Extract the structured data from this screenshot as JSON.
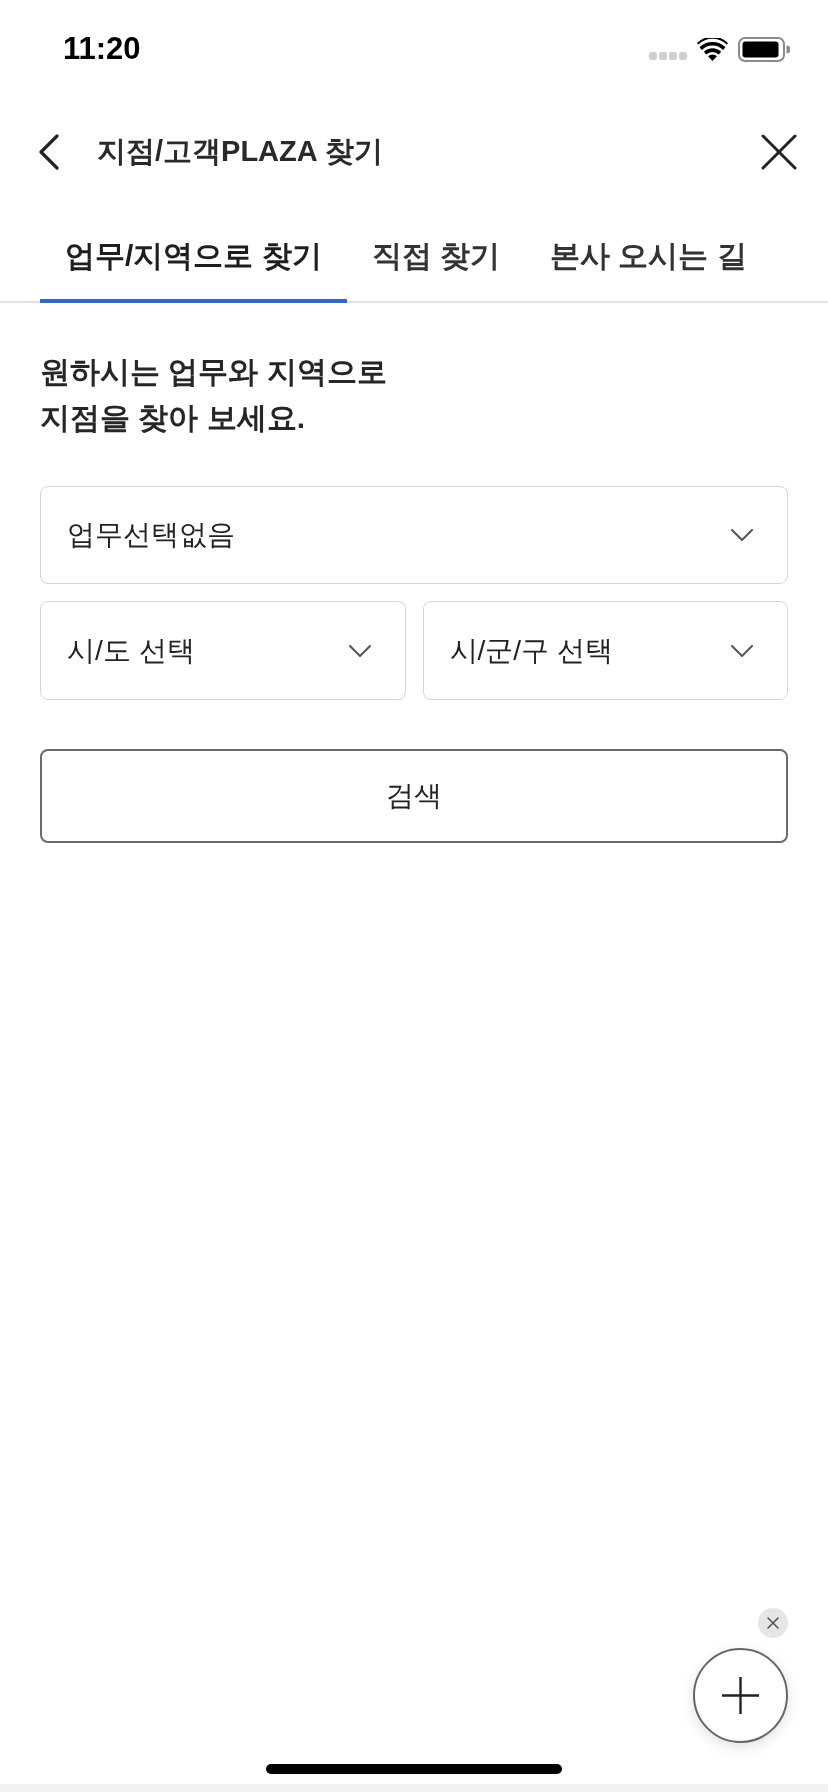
{
  "status_bar": {
    "time": "11:20"
  },
  "header": {
    "title": "지점/고객PLAZA 찾기"
  },
  "tabs": [
    {
      "label": "업무/지역으로 찾기",
      "selected": true
    },
    {
      "label": "직접 찾기",
      "selected": false
    },
    {
      "label": "본사 오시는 길",
      "selected": false
    }
  ],
  "intro": {
    "text": "원하시는 업무와 지역으로\n지점을 찾아 보세요."
  },
  "task_select": {
    "value": "업무선택없음"
  },
  "region_selects": [
    {
      "value": "시/도 선택"
    },
    {
      "value": "시/군/구 선택"
    }
  ],
  "search_button": {
    "label": "검색"
  }
}
